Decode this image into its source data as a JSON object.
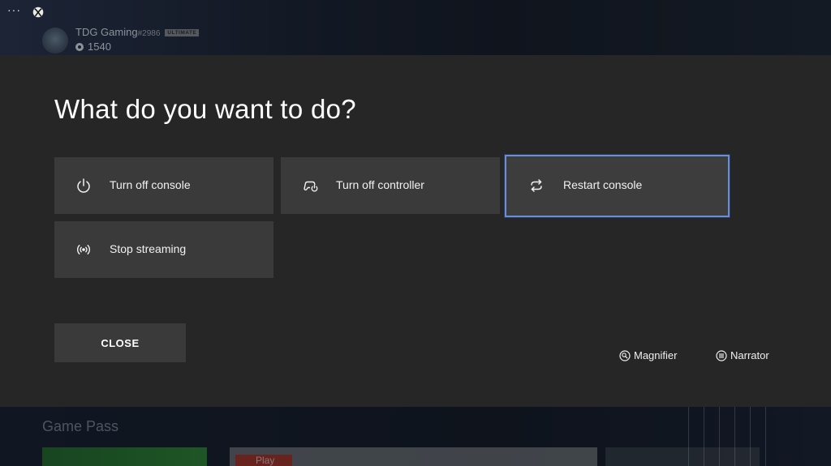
{
  "topbar": {
    "menu_glyph": "···",
    "gamertag": "TDG Gaming",
    "gamertag_suffix": "#2986",
    "badge": "ULTIMATE",
    "gamerscore": "1540"
  },
  "dialog": {
    "title": "What do you want to do?",
    "options": [
      {
        "label": "Turn off console",
        "icon": "power-icon"
      },
      {
        "label": "Turn off controller",
        "icon": "controller-power-icon"
      },
      {
        "label": "Restart console",
        "icon": "restart-icon",
        "focused": true
      },
      {
        "label": "Stop streaming",
        "icon": "streaming-icon"
      }
    ],
    "close_label": "CLOSE",
    "magnifier_label": "Magnifier",
    "narrator_label": "Narrator"
  },
  "background": {
    "section_title": "Game Pass",
    "play_tag": "Play"
  },
  "colors": {
    "overlay_bg": "#262626",
    "tile_bg": "#3a3a3a",
    "focus_border": "#6b8fd6"
  }
}
